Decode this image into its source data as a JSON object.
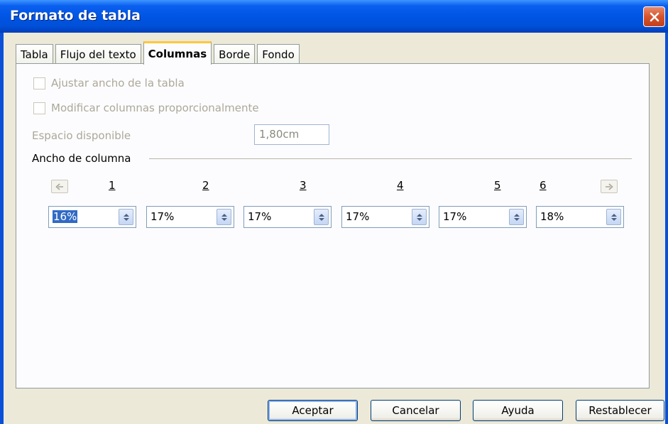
{
  "window": {
    "title": "Formato de tabla"
  },
  "tabs": [
    {
      "label": "Tabla"
    },
    {
      "label": "Flujo del texto"
    },
    {
      "label": "Columnas"
    },
    {
      "label": "Borde"
    },
    {
      "label": "Fondo"
    }
  ],
  "panel": {
    "adjust_width_label": "Ajustar ancho de la tabla",
    "proportional_label": "Modificar columnas proporcionalmente",
    "space_label": "Espacio disponible",
    "space_value": "1,80cm",
    "section_title": "Ancho de columna",
    "columns": [
      {
        "number": "1",
        "value": "16%"
      },
      {
        "number": "2",
        "value": "17%"
      },
      {
        "number": "3",
        "value": "17%"
      },
      {
        "number": "4",
        "value": "17%"
      },
      {
        "number": "5",
        "value": "17%"
      },
      {
        "number": "6",
        "value": "18%"
      }
    ]
  },
  "buttons": {
    "ok": "Aceptar",
    "cancel": "Cancelar",
    "help": "Ayuda",
    "reset": "Restablecer"
  },
  "icons": {
    "close": "close-icon",
    "left_arrow": "arrow-left-icon",
    "right_arrow": "arrow-right-icon",
    "spin": "spin-updown-icon"
  },
  "colors": {
    "title_bar": "#0055E5",
    "active_tab_accent": "#FFC83C",
    "selection": "#316AC5",
    "close_button": "#D6542D"
  }
}
